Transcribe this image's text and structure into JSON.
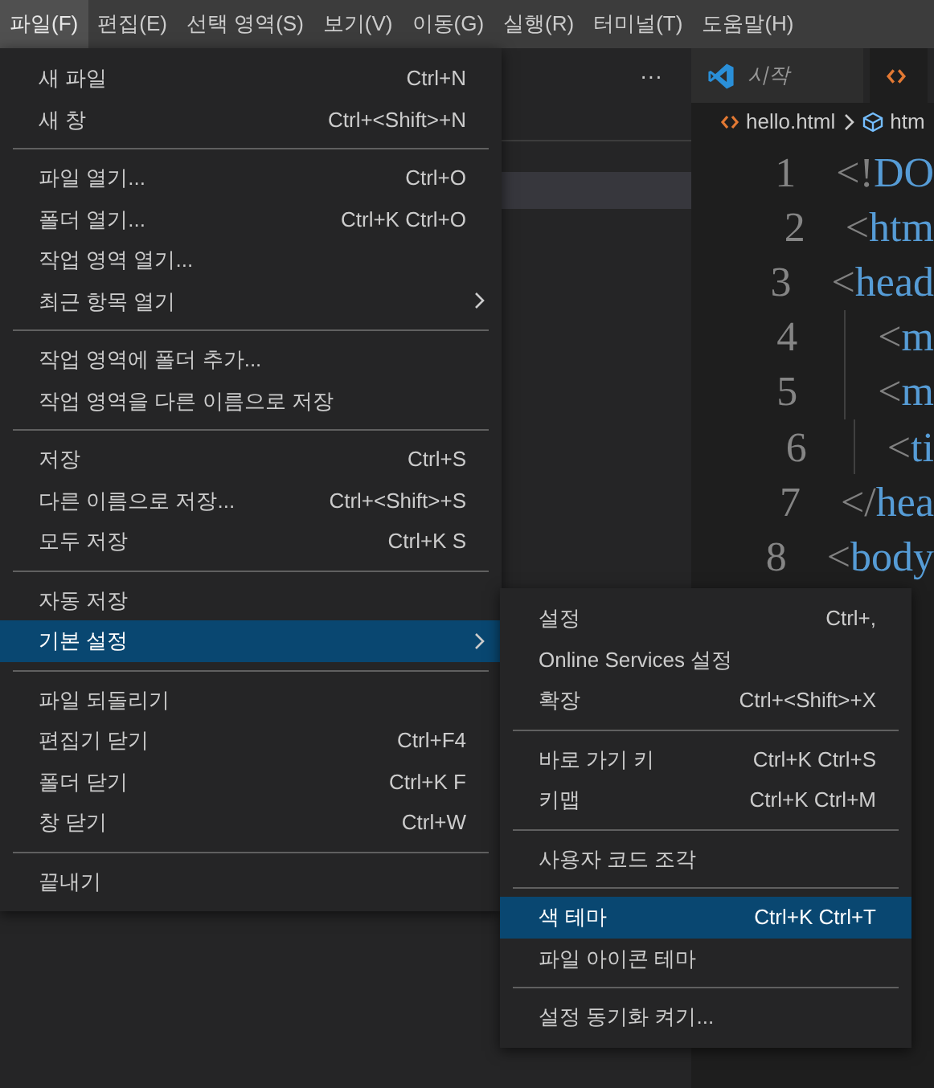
{
  "menubar": [
    {
      "label": "파일(F)",
      "selected": true
    },
    {
      "label": "편집(E)",
      "selected": false
    },
    {
      "label": "선택 영역(S)",
      "selected": false
    },
    {
      "label": "보기(V)",
      "selected": false
    },
    {
      "label": "이동(G)",
      "selected": false
    },
    {
      "label": "실행(R)",
      "selected": false
    },
    {
      "label": "터미널(T)",
      "selected": false
    },
    {
      "label": "도움말(H)",
      "selected": false
    }
  ],
  "side_panel": {
    "more": "···"
  },
  "editor": {
    "tabs": [
      {
        "label": "시작",
        "kind": "start",
        "selected": false
      },
      {
        "kind": "html",
        "selected": true
      }
    ],
    "breadcrumb": [
      {
        "label": "hello.html",
        "kind": "file"
      },
      {
        "label": "htm",
        "kind": "element"
      }
    ],
    "lines": [
      {
        "number": "1",
        "code": "<!DO"
      },
      {
        "number": "2",
        "code": "<htm"
      },
      {
        "number": "3",
        "code": "<head",
        "children": [
          {
            "number": "4",
            "code": "<m"
          },
          {
            "number": "5",
            "code": "<m"
          },
          {
            "number": "6",
            "code": "<ti"
          }
        ]
      },
      {
        "number": "7",
        "code": "</hea"
      },
      {
        "number": "8",
        "code": "<body"
      }
    ]
  },
  "file_menu": [
    [
      {
        "label": "새 파일",
        "shortcut": "Ctrl+N",
        "submenu": false,
        "selected": false
      },
      {
        "label": "새 창",
        "shortcut": "Ctrl+<Shift>+N",
        "submenu": false,
        "selected": false
      }
    ],
    [
      {
        "label": "파일 열기...",
        "shortcut": "Ctrl+O",
        "submenu": false,
        "selected": false
      },
      {
        "label": "폴더 열기...",
        "shortcut": "Ctrl+K Ctrl+O",
        "submenu": false,
        "selected": false
      },
      {
        "label": "작업 영역 열기...",
        "submenu": false,
        "selected": false
      },
      {
        "label": "최근 항목 열기",
        "submenu": true,
        "selected": false
      }
    ],
    [
      {
        "label": "작업 영역에 폴더 추가...",
        "submenu": false,
        "selected": false
      },
      {
        "label": "작업 영역을 다른 이름으로 저장",
        "submenu": false,
        "selected": false
      }
    ],
    [
      {
        "label": "저장",
        "shortcut": "Ctrl+S",
        "submenu": false,
        "selected": false
      },
      {
        "label": "다른 이름으로 저장...",
        "shortcut": "Ctrl+<Shift>+S",
        "submenu": false,
        "selected": false
      },
      {
        "label": "모두 저장",
        "shortcut": "Ctrl+K S",
        "submenu": false,
        "selected": false
      }
    ],
    [
      {
        "label": "자동 저장",
        "submenu": false,
        "selected": false
      },
      {
        "label": "기본 설정",
        "submenu": true,
        "selected": true
      }
    ],
    [
      {
        "label": "파일 되돌리기",
        "submenu": false,
        "selected": false
      },
      {
        "label": "편집기 닫기",
        "shortcut": "Ctrl+F4",
        "submenu": false,
        "selected": false
      },
      {
        "label": "폴더 닫기",
        "shortcut": "Ctrl+K F",
        "submenu": false,
        "selected": false
      },
      {
        "label": "창 닫기",
        "shortcut": "Ctrl+W",
        "submenu": false,
        "selected": false
      }
    ],
    [
      {
        "label": "끝내기",
        "submenu": false,
        "selected": false
      }
    ]
  ],
  "preferences_menu": [
    [
      {
        "label": "설정",
        "shortcut": "Ctrl+,",
        "submenu": false,
        "selected": false
      },
      {
        "label": "Online Services 설정",
        "submenu": false,
        "selected": false
      },
      {
        "label": "확장",
        "shortcut": "Ctrl+<Shift>+X",
        "submenu": false,
        "selected": false
      }
    ],
    [
      {
        "label": "바로 가기 키",
        "shortcut": "Ctrl+K Ctrl+S",
        "submenu": false,
        "selected": false
      },
      {
        "label": "키맵",
        "shortcut": "Ctrl+K Ctrl+M",
        "submenu": false,
        "selected": false
      }
    ],
    [
      {
        "label": "사용자 코드 조각",
        "submenu": false,
        "selected": false
      }
    ],
    [
      {
        "label": "색 테마",
        "shortcut": "Ctrl+K Ctrl+T",
        "submenu": false,
        "selected": true
      },
      {
        "label": "파일 아이콘 테마",
        "submenu": false,
        "selected": false
      }
    ],
    [
      {
        "label": "설정 동기화 켜기...",
        "submenu": false,
        "selected": false
      }
    ]
  ]
}
